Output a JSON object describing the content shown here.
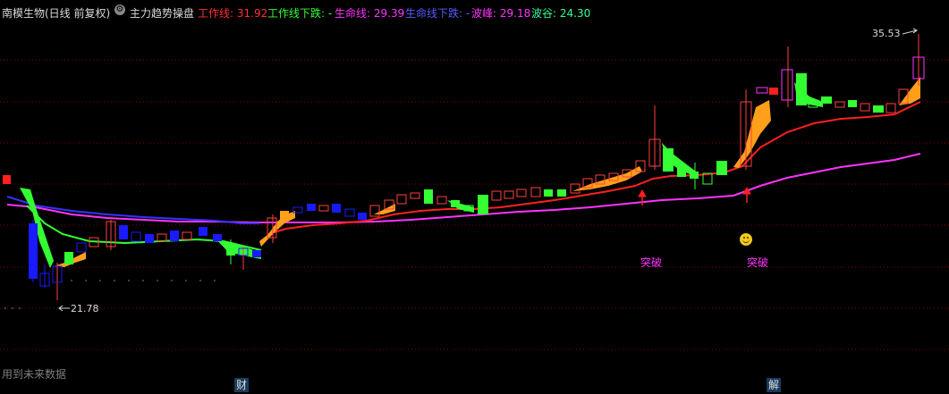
{
  "header": {
    "stock": "南模生物(日线 前复权)",
    "indicator_icon": "gear-icon",
    "indicator_name": "主力趋势操盘",
    "work_line": "工作线: 31.92",
    "work_line_down": "工作线下跌: -",
    "life_line": "生命线: 29.39",
    "life_line_down": "生命线下跌: -",
    "wave_peak": "波峰: 29.18",
    "wave_trough": "波谷: 24.30",
    "colors": {
      "stock": "#d9d9d9",
      "indicator": "#d9d9d9",
      "work_line": "#ff3030",
      "work_line_down": "#33ff33",
      "life_line": "#ff33ff",
      "life_line_down": "#3a3aff",
      "wave_peak": "#ff33ff",
      "wave_trough": "#33ff99"
    }
  },
  "annotations": {
    "high_price": "35.53",
    "low_price": "21.78",
    "breakout_1": "突破",
    "breakout_2": "突破"
  },
  "footer": {
    "note": "用到未来数据",
    "tag_cai": "财",
    "tag_jie": "解"
  },
  "chart_data": {
    "type": "candlestick",
    "series_colors": {
      "up": "#ff3333",
      "down": "#00ffff",
      "work_line": "#ff2020",
      "life_line": "#ff33ff",
      "fill_up": "#ff9f1a",
      "fill_down": "#33ff33",
      "blue_box": "#1a1aff",
      "work_line_blue": "#3333ff"
    }
  }
}
